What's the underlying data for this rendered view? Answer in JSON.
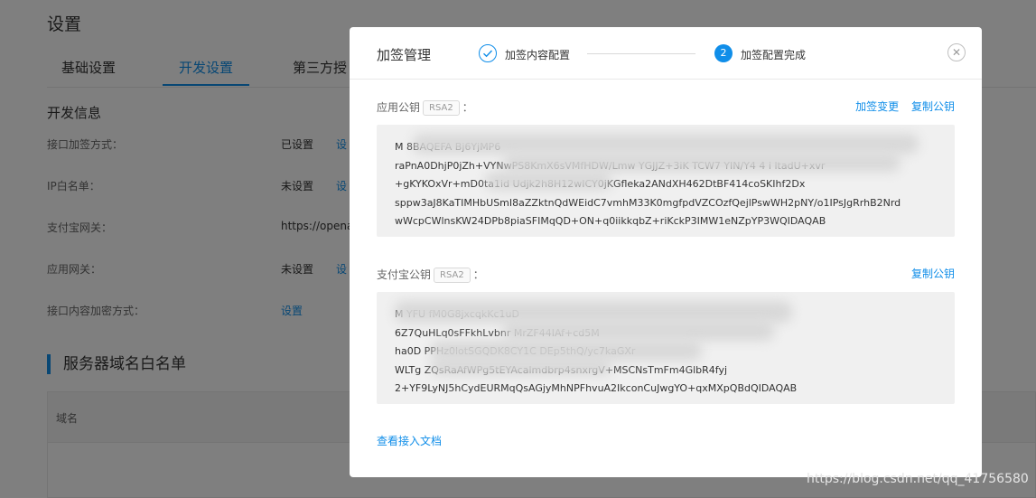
{
  "page": {
    "title": "设置",
    "tabs": [
      "基础设置",
      "开发设置",
      "第三方授"
    ],
    "section_title": "开发信息",
    "rows": [
      {
        "label": "接口加签方式：",
        "value": "已设置",
        "link": "设"
      },
      {
        "label": "IP白名单：",
        "value": "未设置",
        "link": "设"
      },
      {
        "label": "支付宝网关：",
        "value": "https://opena",
        "link": ""
      },
      {
        "label": "应用网关：",
        "value": "未设置",
        "link": "设"
      },
      {
        "label": "接口内容加密方式：",
        "value": "",
        "link": "设置"
      }
    ],
    "whitelist_title": "服务器域名白名单",
    "whitelist_col": "域名"
  },
  "modal": {
    "title": "加签管理",
    "step1_label": "加签内容配置",
    "step2_number": "2",
    "step2_label": "加签配置完成",
    "close_glyph": "✕",
    "app_key": {
      "label": "应用公钥",
      "badge": "RSA2",
      "colon": "：",
      "action_change": "加签变更",
      "action_copy": "复制公钥",
      "lines": [
        "M                         8BAQEFA                                                                    Bj6YjMP6",
        "raPnA0DhjP0jZh+VYNwPS8KmX6sVMfHDW/Lmw              YGJJZ+3iK    TCW7    YIN/Y4   4   i            ltadU+xvr",
        "+gKYKOxVr+mD0ta1id                                 Udjk2h8H12wICY0jKGfleka2ANdXH462DtBF414coSKIhf2Dx",
        "sppw3aJ8KaTIMHbUSmI8aZZktnQdWEidC7vmhM33K0mgfpdVZCOzfQejlPswWH2pNY/o1IPsJgRrhB2Nrd",
        "wWcpCWlnsKW24DPb8piaSFIMqQD+ON+q0iikkqbZ+riKckP3IMW1eNZpYP3WQIDAQAB"
      ]
    },
    "alipay_key": {
      "label": "支付宝公钥",
      "badge": "RSA2",
      "colon": "：",
      "action_copy": "复制公钥",
      "lines": [
        "M                                                                                    YFU   fM0G8jxcqkKc1uD",
        "6Z7QuHLq0sFFkhLvbnr                                                                  MrZF44IAf+cd5M",
        "ha0D                          PPHz0lotSGQDK8CY1C                                  DEp5thQ/yc7kaGXr",
        "WLTg                                              ZQsRaAfWPg5tEYAcalmdbrp4snxrgV+MSCNsTmFm4GlbR4fyj",
        "2+YF9LyNJ5hCydEURMqQsAGjyMhNPFhvuA2IkconCuJwgYO+qxMXpQBdQIDAQAB"
      ]
    },
    "doc_link": "查看接入文档"
  },
  "watermark": "https://blog.csdn.net/qq_41756580",
  "colors": {
    "accent": "#108ee9",
    "key_bg": "#f0f0f0"
  }
}
